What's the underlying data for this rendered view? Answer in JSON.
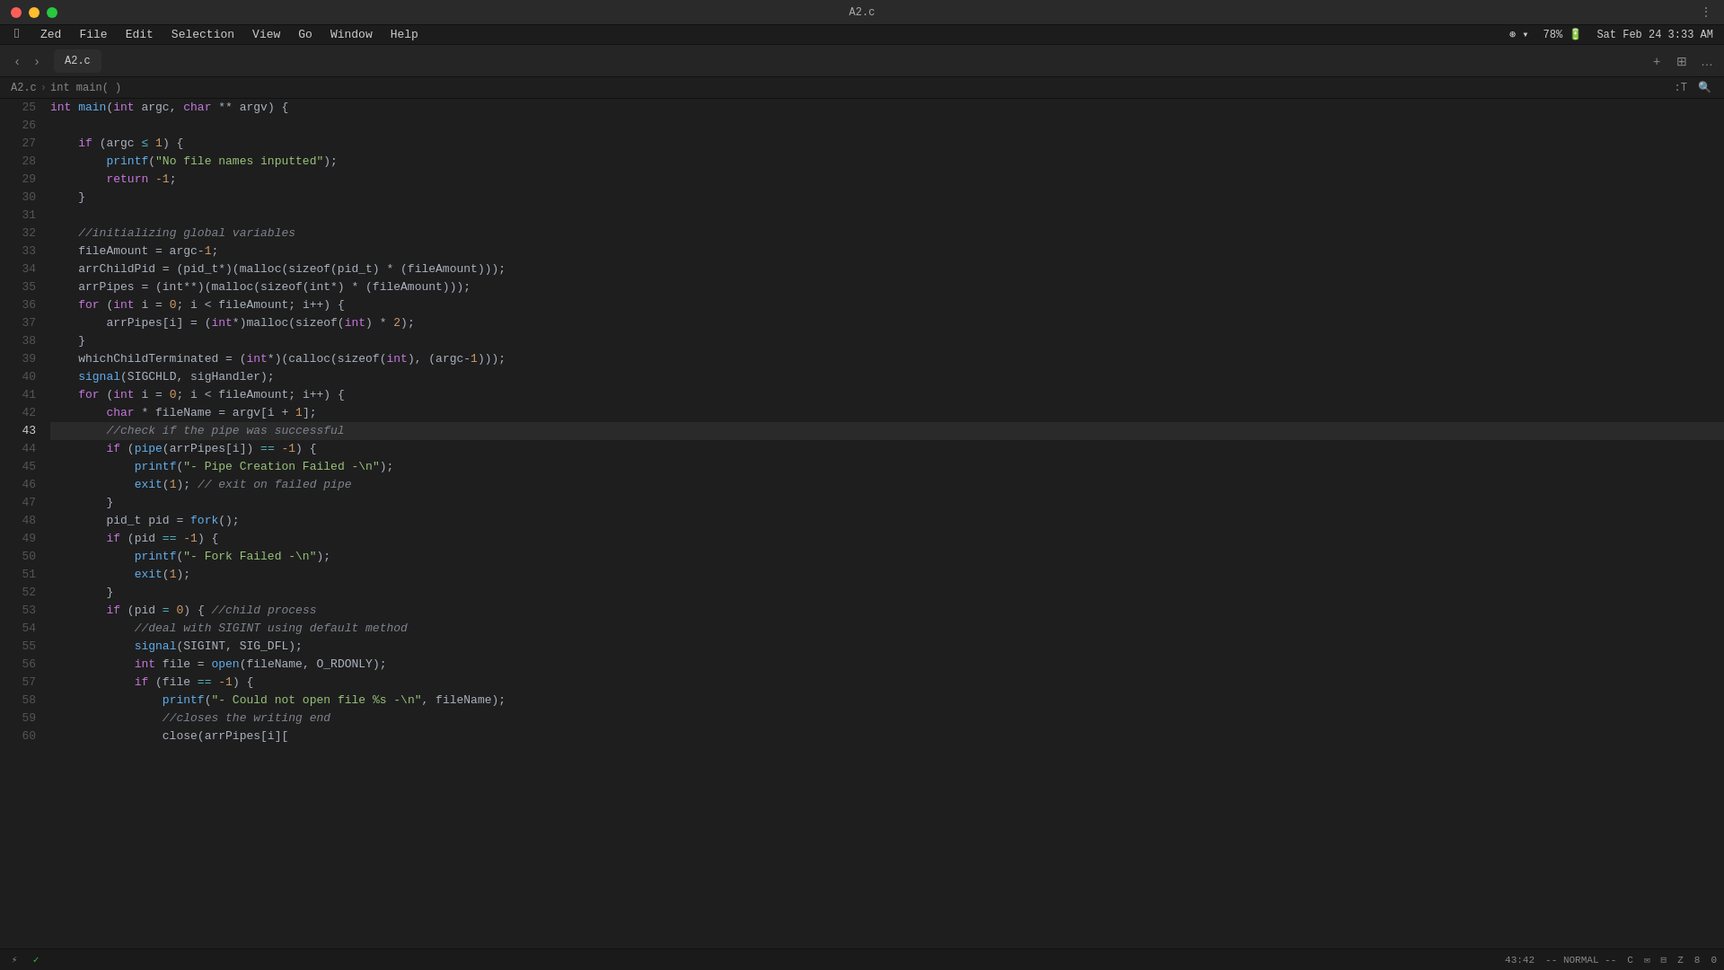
{
  "titleBar": {
    "filename": "A2.c",
    "appName": "Zed"
  },
  "menuBar": {
    "apple": "",
    "items": [
      "Zed",
      "File",
      "Edit",
      "Selection",
      "View",
      "Go",
      "Window",
      "Help"
    ],
    "rightItems": [
      "●●●",
      "WiFi",
      "78%",
      "🔋",
      "Sat Feb 24  3:33 AM"
    ]
  },
  "tabBar": {
    "backLabel": "‹",
    "forwardLabel": "›",
    "tab": "A2.c",
    "addLabel": "+",
    "splitLabel": "⊞",
    "moreLabel": "…"
  },
  "breadcrumb": {
    "file": "A2.c",
    "separator": "›",
    "func": "int main(  )",
    "rightT": ":T",
    "rightSearch": "🔍"
  },
  "editor": {
    "activeLine": 43,
    "lines": [
      {
        "num": 25,
        "tokens": [
          {
            "t": "kw",
            "v": "int"
          },
          {
            "t": "plain",
            "v": " "
          },
          {
            "t": "fn",
            "v": "main"
          },
          {
            "t": "plain",
            "v": "("
          },
          {
            "t": "kw",
            "v": "int"
          },
          {
            "t": "plain",
            "v": " argc, "
          },
          {
            "t": "kw",
            "v": "char"
          },
          {
            "t": "plain",
            "v": " ** argv) {"
          }
        ]
      },
      {
        "num": 26,
        "tokens": [
          {
            "t": "plain",
            "v": ""
          }
        ]
      },
      {
        "num": 27,
        "tokens": [
          {
            "t": "plain",
            "v": "    "
          },
          {
            "t": "kw",
            "v": "if"
          },
          {
            "t": "plain",
            "v": " (argc "
          },
          {
            "t": "op",
            "v": "≤"
          },
          {
            "t": "plain",
            "v": " "
          },
          {
            "t": "num",
            "v": "1"
          },
          {
            "t": "plain",
            "v": ") {"
          }
        ]
      },
      {
        "num": 28,
        "tokens": [
          {
            "t": "plain",
            "v": "        "
          },
          {
            "t": "fn",
            "v": "printf"
          },
          {
            "t": "plain",
            "v": "("
          },
          {
            "t": "str",
            "v": "\"No file names inputted\""
          },
          {
            "t": "plain",
            "v": ");"
          }
        ]
      },
      {
        "num": 29,
        "tokens": [
          {
            "t": "plain",
            "v": "        "
          },
          {
            "t": "kw",
            "v": "return"
          },
          {
            "t": "plain",
            "v": " "
          },
          {
            "t": "num",
            "v": "-1"
          },
          {
            "t": "plain",
            "v": ";"
          }
        ]
      },
      {
        "num": 30,
        "tokens": [
          {
            "t": "plain",
            "v": "    }"
          }
        ]
      },
      {
        "num": 31,
        "tokens": [
          {
            "t": "plain",
            "v": ""
          }
        ]
      },
      {
        "num": 32,
        "tokens": [
          {
            "t": "plain",
            "v": "    "
          },
          {
            "t": "cmt",
            "v": "//initializing global variables"
          }
        ]
      },
      {
        "num": 33,
        "tokens": [
          {
            "t": "plain",
            "v": "    fileAmount = argc-"
          },
          {
            "t": "num",
            "v": "1"
          },
          {
            "t": "plain",
            "v": ";"
          }
        ]
      },
      {
        "num": 34,
        "tokens": [
          {
            "t": "plain",
            "v": "    arrChildPid = (pid_t*)(malloc(sizeof(pid_t) * (fileAmount)));"
          }
        ]
      },
      {
        "num": 35,
        "tokens": [
          {
            "t": "plain",
            "v": "    arrPipes = (int**)(malloc(sizeof(int*) * (fileAmount)));"
          }
        ]
      },
      {
        "num": 36,
        "tokens": [
          {
            "t": "plain",
            "v": "    "
          },
          {
            "t": "kw",
            "v": "for"
          },
          {
            "t": "plain",
            "v": " ("
          },
          {
            "t": "kw",
            "v": "int"
          },
          {
            "t": "plain",
            "v": " i = "
          },
          {
            "t": "num",
            "v": "0"
          },
          {
            "t": "plain",
            "v": "; i < fileAmount; i++) {"
          }
        ]
      },
      {
        "num": 37,
        "tokens": [
          {
            "t": "plain",
            "v": "        arrPipes[i] = ("
          },
          {
            "t": "kw",
            "v": "int"
          },
          {
            "t": "plain",
            "v": "*)malloc(sizeof("
          },
          {
            "t": "kw",
            "v": "int"
          },
          {
            "t": "plain",
            "v": ") * "
          },
          {
            "t": "num",
            "v": "2"
          },
          {
            "t": "plain",
            "v": ");"
          }
        ]
      },
      {
        "num": 38,
        "tokens": [
          {
            "t": "plain",
            "v": "    }"
          }
        ]
      },
      {
        "num": 39,
        "tokens": [
          {
            "t": "plain",
            "v": "    whichChildTerminated = ("
          },
          {
            "t": "kw",
            "v": "int"
          },
          {
            "t": "plain",
            "v": "*)(calloc(sizeof("
          },
          {
            "t": "kw",
            "v": "int"
          },
          {
            "t": "plain",
            "v": "), (argc-"
          },
          {
            "t": "num",
            "v": "1"
          },
          {
            "t": "plain",
            "v": ")));"
          }
        ]
      },
      {
        "num": 40,
        "tokens": [
          {
            "t": "plain",
            "v": "    "
          },
          {
            "t": "fn",
            "v": "signal"
          },
          {
            "t": "plain",
            "v": "(SIGCHLD, sigHandler);"
          }
        ]
      },
      {
        "num": 41,
        "tokens": [
          {
            "t": "plain",
            "v": "    "
          },
          {
            "t": "kw",
            "v": "for"
          },
          {
            "t": "plain",
            "v": " ("
          },
          {
            "t": "kw",
            "v": "int"
          },
          {
            "t": "plain",
            "v": " i = "
          },
          {
            "t": "num",
            "v": "0"
          },
          {
            "t": "plain",
            "v": "; i < fileAmount; i++) {"
          }
        ]
      },
      {
        "num": 42,
        "tokens": [
          {
            "t": "plain",
            "v": "        "
          },
          {
            "t": "kw",
            "v": "char"
          },
          {
            "t": "plain",
            "v": " * fileName = argv[i + "
          },
          {
            "t": "num",
            "v": "1"
          },
          {
            "t": "plain",
            "v": "];"
          }
        ]
      },
      {
        "num": 43,
        "tokens": [
          {
            "t": "plain",
            "v": "        "
          },
          {
            "t": "cmt",
            "v": "//check if the pipe was successful"
          }
        ],
        "active": true
      },
      {
        "num": 44,
        "tokens": [
          {
            "t": "plain",
            "v": "        "
          },
          {
            "t": "kw",
            "v": "if"
          },
          {
            "t": "plain",
            "v": " ("
          },
          {
            "t": "fn",
            "v": "pipe"
          },
          {
            "t": "plain",
            "v": "(arrPipes[i]) "
          },
          {
            "t": "op",
            "v": "=="
          },
          {
            "t": "plain",
            "v": " "
          },
          {
            "t": "num",
            "v": "-1"
          },
          {
            "t": "plain",
            "v": ") {"
          }
        ]
      },
      {
        "num": 45,
        "tokens": [
          {
            "t": "plain",
            "v": "            "
          },
          {
            "t": "fn",
            "v": "printf"
          },
          {
            "t": "plain",
            "v": "("
          },
          {
            "t": "str",
            "v": "\"- Pipe Creation Failed -\\n\""
          },
          {
            "t": "plain",
            "v": ");"
          }
        ]
      },
      {
        "num": 46,
        "tokens": [
          {
            "t": "plain",
            "v": "            "
          },
          {
            "t": "fn",
            "v": "exit"
          },
          {
            "t": "plain",
            "v": "("
          },
          {
            "t": "num",
            "v": "1"
          },
          {
            "t": "plain",
            "v": "); "
          },
          {
            "t": "cmt",
            "v": "// exit on failed pipe"
          }
        ]
      },
      {
        "num": 47,
        "tokens": [
          {
            "t": "plain",
            "v": "        }"
          }
        ]
      },
      {
        "num": 48,
        "tokens": [
          {
            "t": "plain",
            "v": "        pid_t pid = "
          },
          {
            "t": "fn",
            "v": "fork"
          },
          {
            "t": "plain",
            "v": "();"
          }
        ]
      },
      {
        "num": 49,
        "tokens": [
          {
            "t": "plain",
            "v": "        "
          },
          {
            "t": "kw",
            "v": "if"
          },
          {
            "t": "plain",
            "v": " (pid "
          },
          {
            "t": "op",
            "v": "=="
          },
          {
            "t": "plain",
            "v": " "
          },
          {
            "t": "num",
            "v": "-1"
          },
          {
            "t": "plain",
            "v": ") {"
          }
        ]
      },
      {
        "num": 50,
        "tokens": [
          {
            "t": "plain",
            "v": "            "
          },
          {
            "t": "fn",
            "v": "printf"
          },
          {
            "t": "plain",
            "v": "("
          },
          {
            "t": "str",
            "v": "\"- Fork Failed -\\n\""
          },
          {
            "t": "plain",
            "v": ");"
          }
        ]
      },
      {
        "num": 51,
        "tokens": [
          {
            "t": "plain",
            "v": "            "
          },
          {
            "t": "fn",
            "v": "exit"
          },
          {
            "t": "plain",
            "v": "("
          },
          {
            "t": "num",
            "v": "1"
          },
          {
            "t": "plain",
            "v": ");"
          }
        ]
      },
      {
        "num": 52,
        "tokens": [
          {
            "t": "plain",
            "v": "        }"
          }
        ]
      },
      {
        "num": 53,
        "tokens": [
          {
            "t": "plain",
            "v": "        "
          },
          {
            "t": "kw",
            "v": "if"
          },
          {
            "t": "plain",
            "v": " (pid "
          },
          {
            "t": "op",
            "v": "="
          },
          {
            "t": "plain",
            "v": " "
          },
          {
            "t": "num",
            "v": "0"
          },
          {
            "t": "plain",
            "v": ") { "
          },
          {
            "t": "cmt",
            "v": "//child process"
          }
        ]
      },
      {
        "num": 54,
        "tokens": [
          {
            "t": "plain",
            "v": "            "
          },
          {
            "t": "cmt",
            "v": "//deal with SIGINT using default method"
          }
        ]
      },
      {
        "num": 55,
        "tokens": [
          {
            "t": "plain",
            "v": "            "
          },
          {
            "t": "fn",
            "v": "signal"
          },
          {
            "t": "plain",
            "v": "(SIGINT, SIG_DFL);"
          }
        ]
      },
      {
        "num": 56,
        "tokens": [
          {
            "t": "plain",
            "v": "            "
          },
          {
            "t": "kw",
            "v": "int"
          },
          {
            "t": "plain",
            "v": " file = "
          },
          {
            "t": "fn",
            "v": "open"
          },
          {
            "t": "plain",
            "v": "(fileName, O_RDONLY);"
          }
        ]
      },
      {
        "num": 57,
        "tokens": [
          {
            "t": "plain",
            "v": "            "
          },
          {
            "t": "kw",
            "v": "if"
          },
          {
            "t": "plain",
            "v": " (file "
          },
          {
            "t": "op",
            "v": "=="
          },
          {
            "t": "plain",
            "v": " "
          },
          {
            "t": "num",
            "v": "-1"
          },
          {
            "t": "plain",
            "v": ") {"
          }
        ]
      },
      {
        "num": 58,
        "tokens": [
          {
            "t": "plain",
            "v": "                "
          },
          {
            "t": "fn",
            "v": "printf"
          },
          {
            "t": "plain",
            "v": "("
          },
          {
            "t": "str",
            "v": "\"- Could not open file %s -\\n\""
          },
          {
            "t": "plain",
            "v": ", fileName);"
          }
        ]
      },
      {
        "num": 59,
        "tokens": [
          {
            "t": "plain",
            "v": "                "
          },
          {
            "t": "cmt",
            "v": "//closes the writing end"
          }
        ]
      },
      {
        "num": 60,
        "tokens": [
          {
            "t": "plain",
            "v": "                close(arrPipes[i]["
          }
        ]
      }
    ]
  },
  "statusBar": {
    "leftItems": [
      "⚡",
      "✓"
    ],
    "position": "43:42",
    "mode": "NORMAL",
    "lang": "C",
    "iconItems": [
      "✉",
      "⊟",
      "Z",
      "8",
      "0"
    ]
  }
}
